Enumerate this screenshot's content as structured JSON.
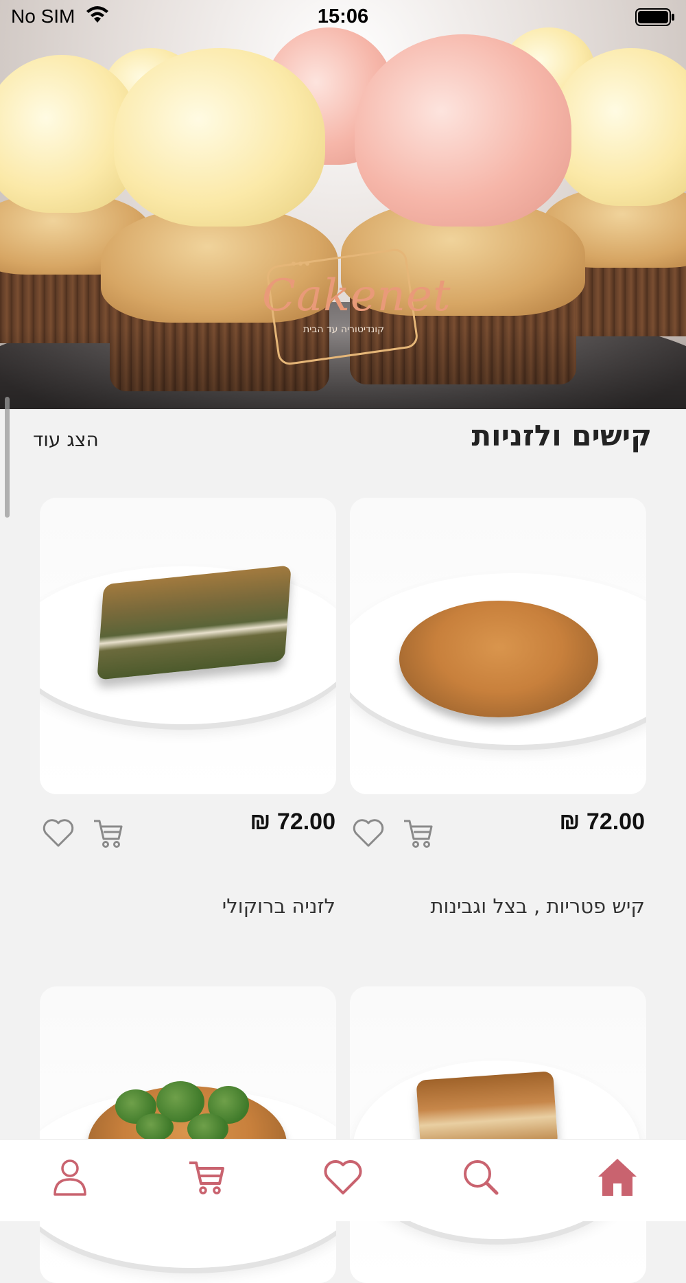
{
  "status_bar": {
    "carrier": "No SIM",
    "time": "15:06"
  },
  "hero": {
    "logo_text": "Cakenet",
    "logo_subtitle": "קונדיטוריה עד הבית"
  },
  "section": {
    "title": "קישים ולזניות",
    "show_more_label": "הצג עוד"
  },
  "products": [
    {
      "name": "קיש פטריות , בצל וגבינות",
      "price": "72.00 ₪"
    },
    {
      "name": "לזניה ברוקולי",
      "price": "72.00 ₪"
    }
  ],
  "bottom_nav": {
    "items": [
      "home-icon",
      "search-icon",
      "heart-icon",
      "cart-icon",
      "user-icon"
    ],
    "accent_color": "#c9636f"
  },
  "colors": {
    "icon_gray": "#8a8a8a",
    "accent": "#c9636f",
    "background": "#f2f2f2"
  }
}
